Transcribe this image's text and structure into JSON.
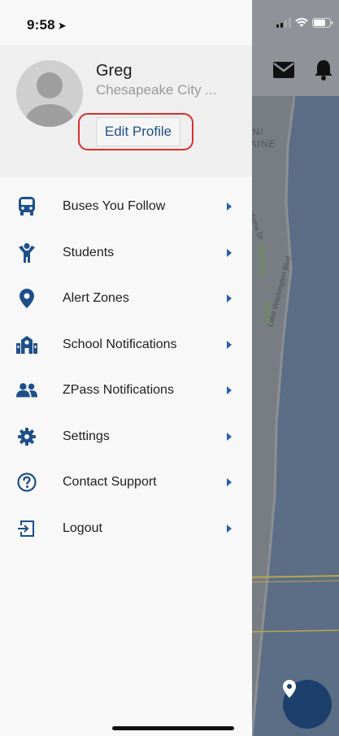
{
  "status_bar": {
    "time": "9:58",
    "location_arrow": "location-arrow-icon"
  },
  "profile": {
    "name": "Greg",
    "location": "Chesapeake City ...",
    "edit_label": "Edit Profile"
  },
  "menu": {
    "items": [
      {
        "label": "Buses You Follow",
        "icon": "bus-icon"
      },
      {
        "label": "Students",
        "icon": "student-icon"
      },
      {
        "label": "Alert Zones",
        "icon": "map-pin-icon"
      },
      {
        "label": "School Notifications",
        "icon": "school-icon"
      },
      {
        "label": "ZPass Notifications",
        "icon": "users-icon"
      },
      {
        "label": "Settings",
        "icon": "gear-icon"
      },
      {
        "label": "Contact Support",
        "icon": "question-circle-icon"
      },
      {
        "label": "Logout",
        "icon": "logout-icon"
      }
    ]
  },
  "map": {
    "labels": {
      "area_line1": "ON/",
      "area_line2": "LAINE"
    },
    "streets": {
      "madrona": "Madrona Dr",
      "lake_washington": "Lake Washington Blvd"
    }
  },
  "colors": {
    "accent": "#2660a8",
    "edit_ring": "#d9302c",
    "fab": "#1d3f6b",
    "water": "#5b6e86"
  }
}
